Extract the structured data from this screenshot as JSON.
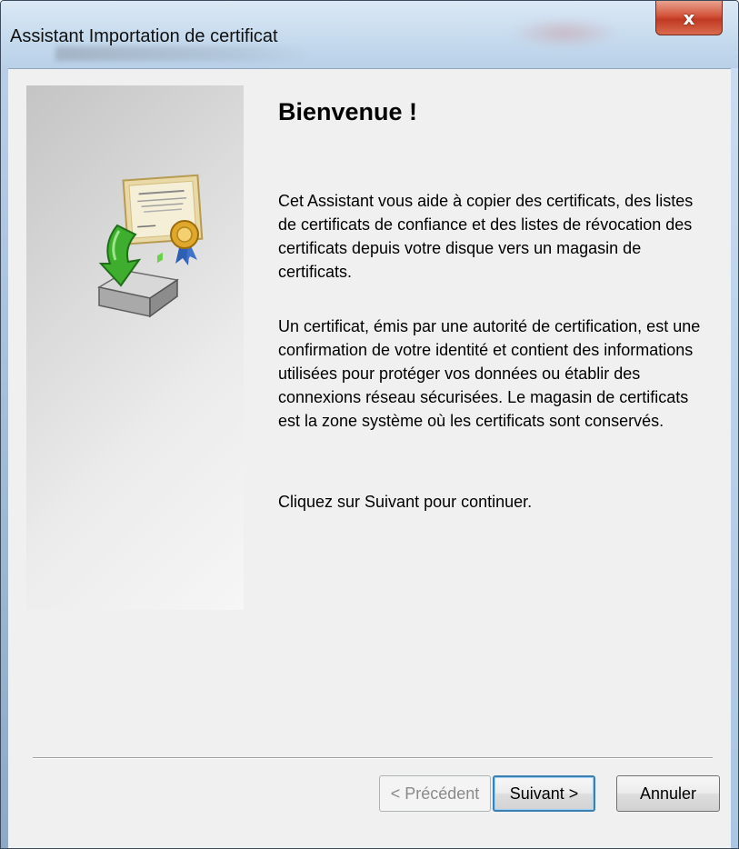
{
  "window": {
    "title": "Assistant Importation de certificat",
    "close_label": "x"
  },
  "side_panel": {
    "icon": "certificate-import-icon"
  },
  "content": {
    "heading": "Bienvenue !",
    "paragraph1": "Cet Assistant vous aide à copier des certificats, des listes de certificats de confiance et des listes de révocation des certificats depuis votre disque vers un magasin de certificats.",
    "paragraph2": "Un certificat, émis par une autorité de certification, est une confirmation de votre identité et contient des informations utilisées pour protéger vos données ou établir des connexions réseau sécurisées. Le magasin de certificats est la zone système où les certificats sont conservés.",
    "paragraph3": "Cliquez sur Suivant pour continuer."
  },
  "buttons": {
    "previous": "< Précédent",
    "next": "Suivant >",
    "cancel": "Annuler"
  },
  "colors": {
    "close_button": "#d4523a",
    "default_button_border": "#3c7fb1",
    "dialog_background": "#f0f0f0"
  }
}
